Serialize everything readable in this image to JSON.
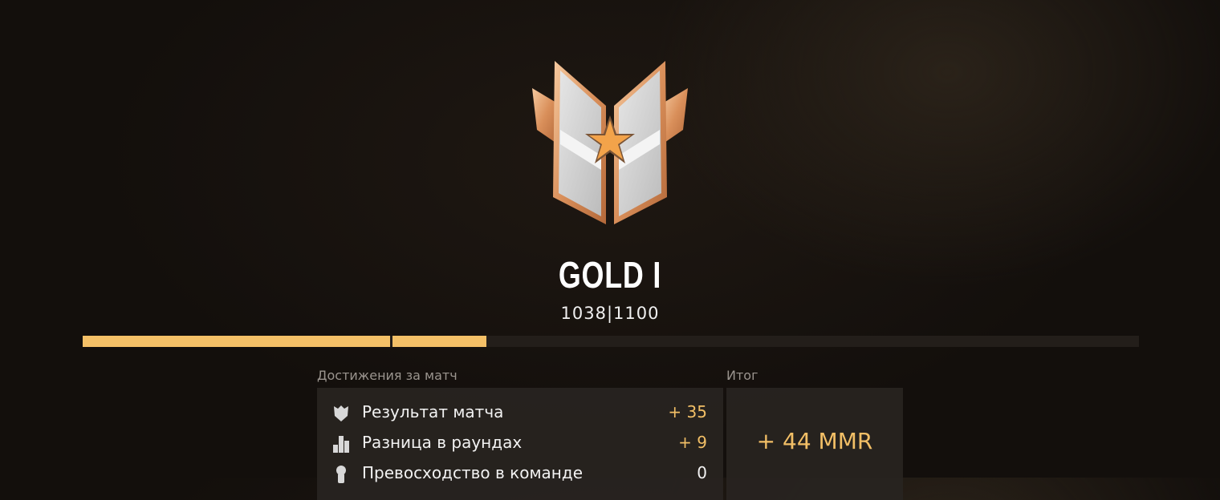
{
  "rank": {
    "title": "GOLD I",
    "points_text": "1038|1100",
    "current_points": 1038,
    "next_rank_points": 1100,
    "progress_previous_fraction": 0.291,
    "progress_current_fraction": 0.382
  },
  "match_breakdown": {
    "label": "Достижения за матч",
    "rows": [
      {
        "icon": "shield-icon",
        "label": "Результат матча",
        "value": "+ 35",
        "value_color": "#f2bf66"
      },
      {
        "icon": "bar-chart-icon",
        "label": "Разница в раундах",
        "value": "+ 9",
        "value_color": "#f2bf66"
      },
      {
        "icon": "person-icon",
        "label": "Превосходство в команде",
        "value": "0",
        "value_color": "#f2f2f2"
      }
    ]
  },
  "total": {
    "label": "Итог",
    "value": "+ 44 MMR"
  },
  "colors": {
    "accent": "#f4c067",
    "background": "#140f0c",
    "panel": "#28241f",
    "muted_text": "#9a948e"
  }
}
